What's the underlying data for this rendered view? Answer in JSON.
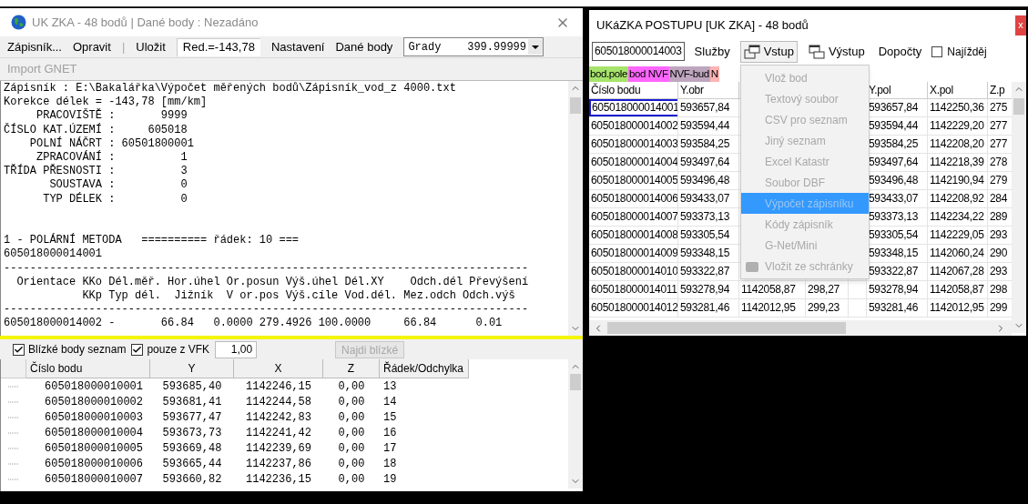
{
  "left_window": {
    "title": "UK ZKA - 48 bodů | Dané body : Nezadáno",
    "menu": [
      {
        "kind": "item",
        "label": "Zápisník..."
      },
      {
        "kind": "item",
        "label": "Opravit"
      },
      {
        "kind": "separator",
        "label": "|"
      },
      {
        "kind": "item",
        "label": "Uložit"
      },
      {
        "kind": "readout",
        "label": "Red.=-143,78"
      },
      {
        "kind": "item",
        "label": "Nastavení"
      },
      {
        "kind": "item",
        "label": "Dané body"
      },
      {
        "kind": "select",
        "label": "Grady    399.99999"
      }
    ],
    "secondary_menu": [
      {
        "label": "Import GNET",
        "disabled": true
      }
    ],
    "console_text": "Zápisník : E:\\Bakalářka\\Výpočet měřených bodů\\Zápisník_vod_z 4000.txt\nKorekce délek = -143,78 [mm/km]\n     PRACOVIŠTĚ :       9999\nČÍSLO KAT.ÚZEMÍ :     605018\n    POLNÍ NÁČRT : 60501800001\n     ZPRACOVÁNÍ :          1\nTŘÍDA PŘESNOSTI :          3\n       SOUSTAVA :          0\n      TYP DÉLEK :          0\n\n\n1 - POLÁRNÍ METODA   ========== řádek: 10 ===\n605018000014001\n--------------------------------------------------------------------------------\n  Orientace KKo Dél.měř. Hor.úhel Or.posun Výš.úhel Dél.XY    Odch.dél Převýšení\n            KKp Typ dél.  Jižník  V or.pos Výš.cíle Vod.dél. Mez.odch Odch.výš\n--------------------------------------------------------------------------------\n605018000014002 -       66.84   0.0000 279.4926 100.0000     66.84      0.01",
    "filter": {
      "checks": [
        {
          "label": "Blízké body seznam",
          "checked": true
        },
        {
          "label": "pouze z VFK",
          "checked": true
        }
      ],
      "distance": "1,00",
      "find_button": {
        "label": "Najdi blízké",
        "disabled": true
      }
    },
    "near_table": {
      "columns": [
        "Číslo bodu",
        "Y",
        "X",
        "Z",
        "Řádek/Odchylka"
      ],
      "rows": [
        [
          "605018000010001",
          "593685,40",
          "1142246,15",
          "0,00",
          "13"
        ],
        [
          "605018000010002",
          "593681,41",
          "1142244,58",
          "0,00",
          "14"
        ],
        [
          "605018000010003",
          "593677,47",
          "1142242,83",
          "0,00",
          "15"
        ],
        [
          "605018000010004",
          "593673,73",
          "1142241,42",
          "0,00",
          "16"
        ],
        [
          "605018000010005",
          "593669,48",
          "1142239,69",
          "0,00",
          "17"
        ],
        [
          "605018000010006",
          "593665,44",
          "1142237,86",
          "0,00",
          "18"
        ],
        [
          "605018000010007",
          "593660,82",
          "1142236,15",
          "0,00",
          "19"
        ]
      ]
    }
  },
  "right_window": {
    "title": "UKáZKA POSTUPU [UK ZKA] - 48 bodů",
    "close": "x",
    "point_field": "605018000014003",
    "toolbar": [
      {
        "kind": "text",
        "label": "Služby",
        "selected": false
      },
      {
        "kind": "input",
        "label": "Vstup",
        "selected": true
      },
      {
        "kind": "output",
        "label": "Výstup",
        "selected": false
      },
      {
        "kind": "text",
        "label": "Dopočty",
        "selected": false
      },
      {
        "kind": "check",
        "label": "Najížděj",
        "selected": false
      }
    ],
    "legend": [
      {
        "label": "bod.pole",
        "color": "#a6e36b"
      },
      {
        "label": "bod NVF",
        "color": "#ff66ff"
      },
      {
        "label": "NVF-bud",
        "color": "#bfa6bf"
      },
      {
        "label": "N",
        "color": "#ffb3b3"
      }
    ],
    "menu": [
      {
        "label": "Vlož bod",
        "disabled": true,
        "selected": false
      },
      {
        "label": "Textový soubor",
        "disabled": true,
        "selected": false
      },
      {
        "label": "CSV pro seznam",
        "disabled": true,
        "selected": false
      },
      {
        "label": "Jiný seznam",
        "disabled": true,
        "selected": false
      },
      {
        "label": "Excel Katastr",
        "disabled": true,
        "selected": false
      },
      {
        "label": "Soubor DBF",
        "disabled": true,
        "selected": false
      },
      {
        "label": "Výpočet zápisníku",
        "disabled": true,
        "selected": true
      },
      {
        "label": "Kódy zápisník",
        "disabled": true,
        "selected": false
      },
      {
        "label": "G-Net/Mini",
        "disabled": true,
        "selected": false
      },
      {
        "label": "Vložit ze schránky",
        "disabled": true,
        "selected": false
      }
    ],
    "table": {
      "columns": [
        "Číslo bodu",
        "Y.obr",
        null,
        null,
        null,
        "Y.pol",
        "X.pol",
        "Z.p"
      ],
      "rows": [
        {
          "selected": true,
          "cells": [
            "605018000014001",
            "593657,84",
            null,
            null,
            null,
            "593657,84",
            "1142250,36",
            "275"
          ]
        },
        {
          "selected": false,
          "cells": [
            "605018000014002",
            "593594,44",
            null,
            null,
            null,
            "593594,44",
            "1142229,20",
            "277"
          ]
        },
        {
          "selected": false,
          "cells": [
            "605018000014003",
            "593584,25",
            null,
            null,
            null,
            "593584,25",
            "1142208,20",
            "277"
          ]
        },
        {
          "selected": false,
          "cells": [
            "605018000014004",
            "593497,64",
            null,
            null,
            null,
            "593497,64",
            "1142218,39",
            "278"
          ]
        },
        {
          "selected": false,
          "cells": [
            "605018000014005",
            "593496,48",
            null,
            null,
            null,
            "593496,48",
            "1142190,94",
            "279"
          ]
        },
        {
          "selected": false,
          "cells": [
            "605018000014006",
            "593433,07",
            null,
            null,
            null,
            "593433,07",
            "1142208,92",
            "284"
          ]
        },
        {
          "selected": false,
          "cells": [
            "605018000014007",
            "593373,13",
            null,
            null,
            null,
            "593373,13",
            "1142234,22",
            "289"
          ]
        },
        {
          "selected": false,
          "cells": [
            "605018000014008",
            "593305,54",
            null,
            null,
            null,
            "593305,54",
            "1142229,05",
            "293"
          ]
        },
        {
          "selected": false,
          "cells": [
            "605018000014009",
            "593348,15",
            null,
            null,
            null,
            "593348,15",
            "1142060,24",
            "290"
          ]
        },
        {
          "selected": false,
          "cells": [
            "605018000014010",
            "593322,87",
            null,
            null,
            null,
            "593322,87",
            "1142067,28",
            "293"
          ]
        },
        {
          "selected": false,
          "cells": [
            "605018000014011",
            "593278,94",
            "1142058,87",
            "298,27",
            null,
            "593278,94",
            "1142058,87",
            "298"
          ]
        },
        {
          "selected": false,
          "cells": [
            "605018000014012",
            "593281,46",
            "1142012,95",
            "299,23",
            null,
            "593281,46",
            "1142012,95",
            "299"
          ]
        }
      ]
    }
  }
}
